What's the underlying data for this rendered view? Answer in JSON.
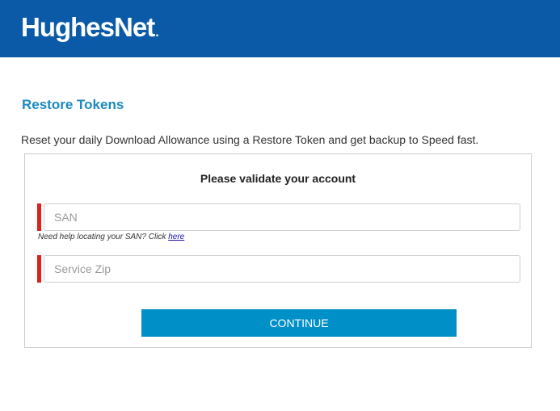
{
  "header": {
    "brand": "HughesNet",
    "brand_mark": ".",
    "background_color": "#0a5aa8"
  },
  "page": {
    "title": "Restore Tokens",
    "intro": "Reset your daily Download Allowance using a Restore Token and get backup to Speed fast."
  },
  "form": {
    "heading": "Please validate your account",
    "san": {
      "placeholder": "SAN",
      "value": ""
    },
    "help_text": "Need help locating your SAN? Click ",
    "help_link": "here",
    "zip": {
      "placeholder": "Service Zip",
      "value": ""
    },
    "submit_label": "CONTINUE",
    "required_color": "#e0201a",
    "accent_color": "#0090c8"
  }
}
